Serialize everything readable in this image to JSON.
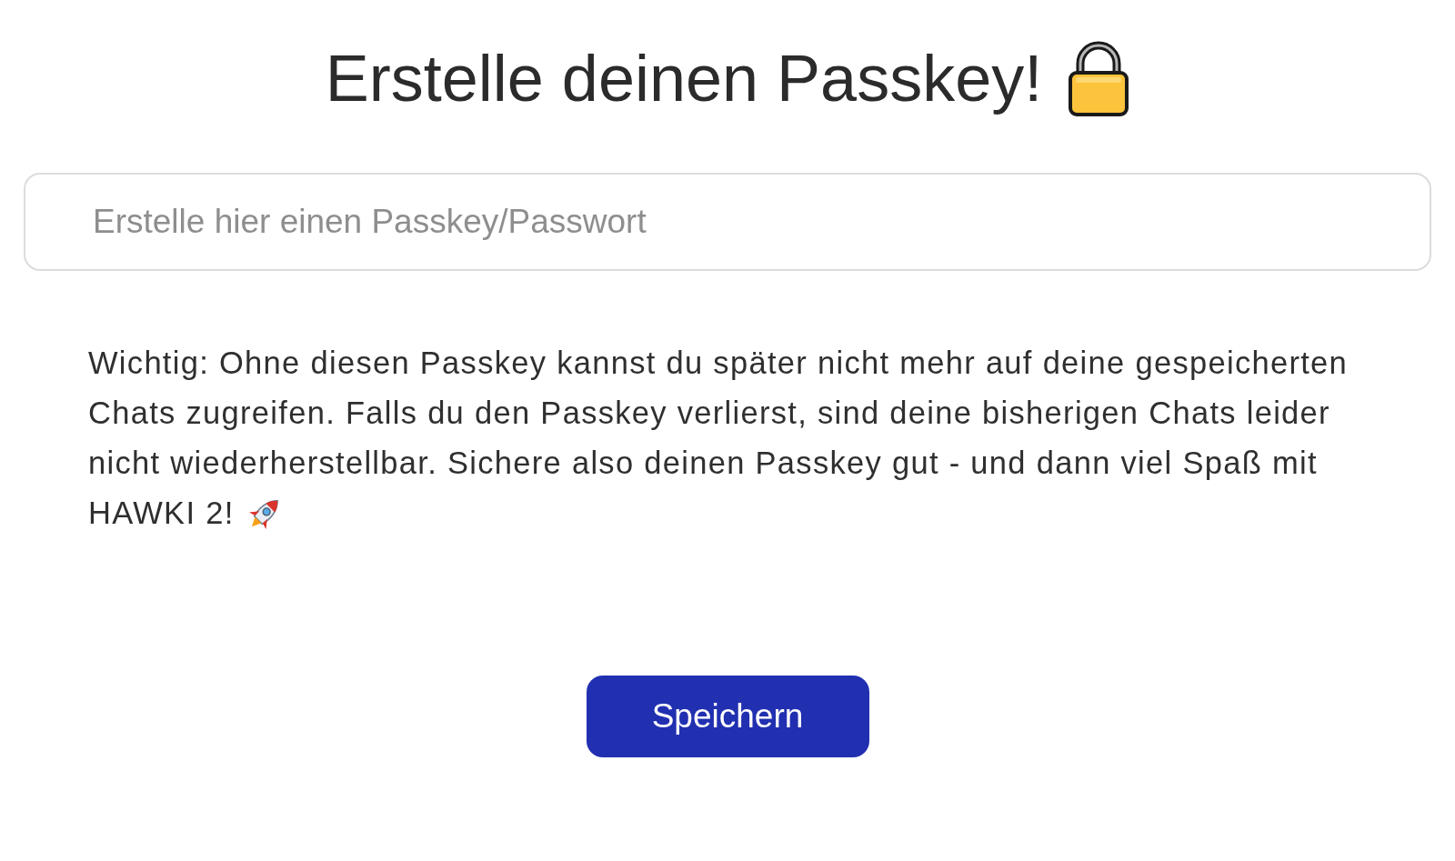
{
  "title": {
    "text": "Erstelle deinen Passkey!"
  },
  "passkey_field": {
    "placeholder": "Erstelle hier einen Passkey/Passwort"
  },
  "notice": {
    "lines": [
      "Wichtig: Ohne diesen Passkey kannst du später nicht mehr auf deine gespeicherten",
      "Chats zugreifen. Falls du den Passkey verlierst, sind deine bisherigen Chats leider",
      "nicht wiederherstellbar. Sichere also deinen Passkey gut - und dann viel Spaß mit",
      "HAWKI 2!"
    ]
  },
  "save_button": {
    "label": "Speichern"
  }
}
